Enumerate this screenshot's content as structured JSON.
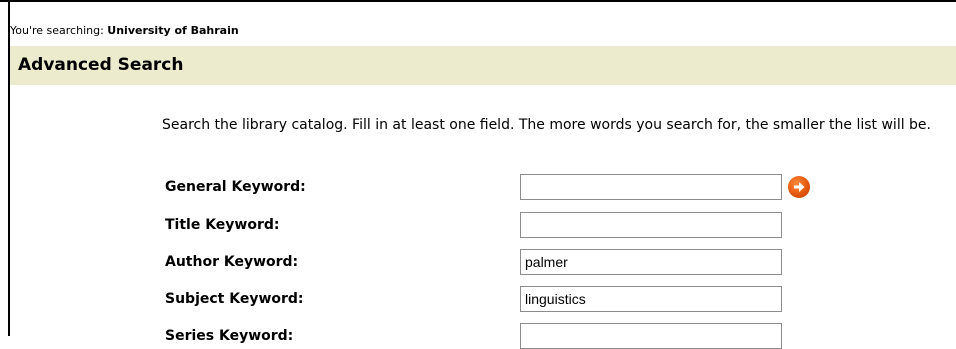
{
  "header": {
    "scope_prefix": "You're searching: ",
    "scope_name": "University of Bahrain",
    "title": "Advanced Search"
  },
  "intro_text": "Search the library catalog. Fill in at least one field. The more words you search for, the smaller the list will be.",
  "fields": [
    {
      "label": "General Keyword:",
      "value": ""
    },
    {
      "label": "Title Keyword:",
      "value": ""
    },
    {
      "label": "Author Keyword:",
      "value": "palmer"
    },
    {
      "label": "Subject Keyword:",
      "value": "linguistics"
    },
    {
      "label": "Series Keyword:",
      "value": ""
    }
  ],
  "go_button": {
    "icon": "arrow-right-icon",
    "color": "#e0530b"
  }
}
